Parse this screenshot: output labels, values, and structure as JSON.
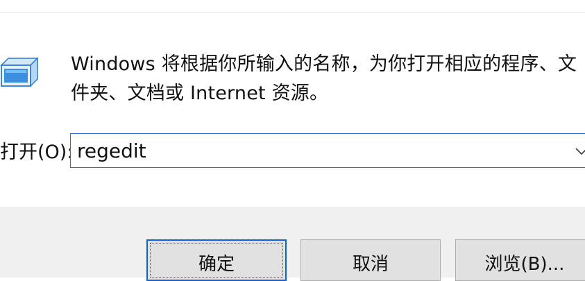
{
  "dialog": {
    "description": "Windows 将根据你所输入的名称，为你打开相应的程序、文件夹、文档或 Internet 资源。",
    "open_label": "打开(O):",
    "open_value": "regedit",
    "icons": {
      "run": "run-dialog-icon",
      "dropdown": "chevron-down-icon"
    }
  },
  "buttons": {
    "ok": "确定",
    "cancel": "取消",
    "browse": "浏览(B)..."
  },
  "colors": {
    "accent": "#0a64d2",
    "input_border": "#2b6fd1",
    "footer_bg": "#f0f0f0",
    "button_bg": "#e1e1e1"
  }
}
